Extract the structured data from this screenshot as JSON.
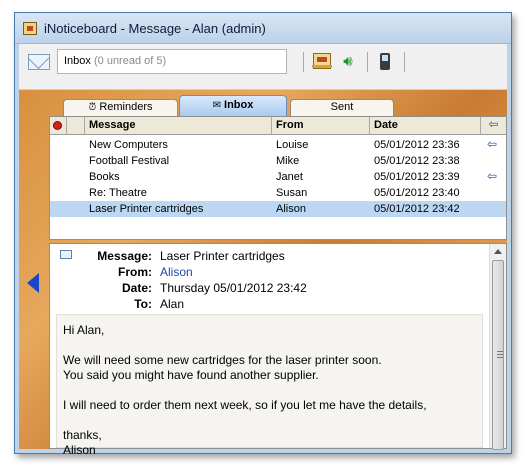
{
  "window": {
    "title": "iNoticeboard - Message - Alan (admin)"
  },
  "toolbar": {
    "folder_name": "Inbox",
    "folder_status": "(0 unread of 5)",
    "icons": [
      "envelope-icon",
      "noticeboard-icon",
      "speaker-icon",
      "mobile-phone-icon"
    ]
  },
  "tabs": [
    {
      "label": "Reminders",
      "icon": "alarm-clock-icon",
      "active": false
    },
    {
      "label": "Inbox",
      "icon": "envelope-icon",
      "active": true
    },
    {
      "label": "Sent",
      "icon": "",
      "active": false
    }
  ],
  "message_list": {
    "columns": {
      "message": "Message",
      "from": "From",
      "date": "Date"
    },
    "rows": [
      {
        "message": "New Computers",
        "from": "Louise",
        "date": "05/01/2012 23:36",
        "replied": true,
        "selected": false
      },
      {
        "message": "Football Festival",
        "from": "Mike",
        "date": "05/01/2012 23:38",
        "replied": false,
        "selected": false
      },
      {
        "message": "Books",
        "from": "Janet",
        "date": "05/01/2012 23:39",
        "replied": true,
        "selected": false
      },
      {
        "message": "Re: Theatre",
        "from": "Susan",
        "date": "05/01/2012 23:40",
        "replied": false,
        "selected": false
      },
      {
        "message": "Laser Printer cartridges",
        "from": "Alison",
        "date": "05/01/2012 23:42",
        "replied": false,
        "selected": true
      }
    ]
  },
  "reader": {
    "labels": {
      "message": "Message:",
      "from": "From:",
      "date": "Date:",
      "to": "To:"
    },
    "message": "Laser Printer cartridges",
    "from": "Alison",
    "date": "Thursday 05/01/2012 23:42",
    "to": "Alan",
    "body": {
      "greeting": "Hi Alan,",
      "para1_line1": "We will need some new cartridges for the laser printer soon.",
      "para1_line2": "You said you might have found another supplier.",
      "para2": "I will need to order them next week, so if you let me have the details,",
      "closing": "thanks,",
      "signature": "Alison"
    }
  },
  "colors": {
    "accent": "#1c46c9",
    "selected_row": "#bcd7f3",
    "priority": "#d0221b"
  }
}
